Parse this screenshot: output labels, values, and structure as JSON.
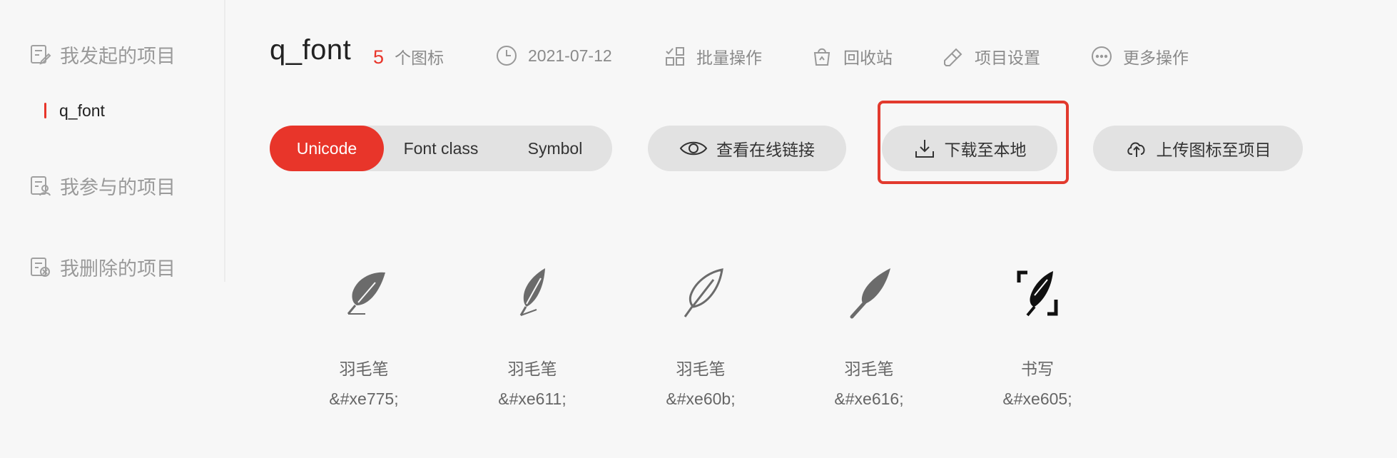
{
  "sidebar": {
    "my_projects": "我发起的项目",
    "projects": [
      {
        "label": "q_font"
      }
    ],
    "joined_projects": "我参与的项目",
    "deleted_projects": "我删除的项目"
  },
  "header": {
    "title": "q_font",
    "icon_count": "5",
    "icon_count_unit": "个图标",
    "date": "2021-07-12",
    "batch": "批量操作",
    "recycle": "回收站",
    "settings": "项目设置",
    "more": "更多操作"
  },
  "toolbar": {
    "tabs": [
      {
        "label": "Unicode",
        "active": true
      },
      {
        "label": "Font class",
        "active": false
      },
      {
        "label": "Symbol",
        "active": false
      }
    ],
    "view_link": "查看在线链接",
    "download": "下载至本地",
    "upload": "上传图标至项目"
  },
  "icons": [
    {
      "name": "羽毛笔",
      "code": "&#xe775;",
      "icon": "feather-icon"
    },
    {
      "name": "羽毛笔",
      "code": "&#xe611;",
      "icon": "feather-icon"
    },
    {
      "name": "羽毛笔",
      "code": "&#xe60b;",
      "icon": "feather-outline-icon"
    },
    {
      "name": "羽毛笔",
      "code": "&#xe616;",
      "icon": "feather-icon"
    },
    {
      "name": "书写",
      "code": "&#xe605;",
      "icon": "writing-icon"
    }
  ],
  "colors": {
    "accent": "#e8352a",
    "background": "#f7f7f7",
    "pill": "#e2e2e2",
    "highlight_box": "#e23a2e"
  }
}
